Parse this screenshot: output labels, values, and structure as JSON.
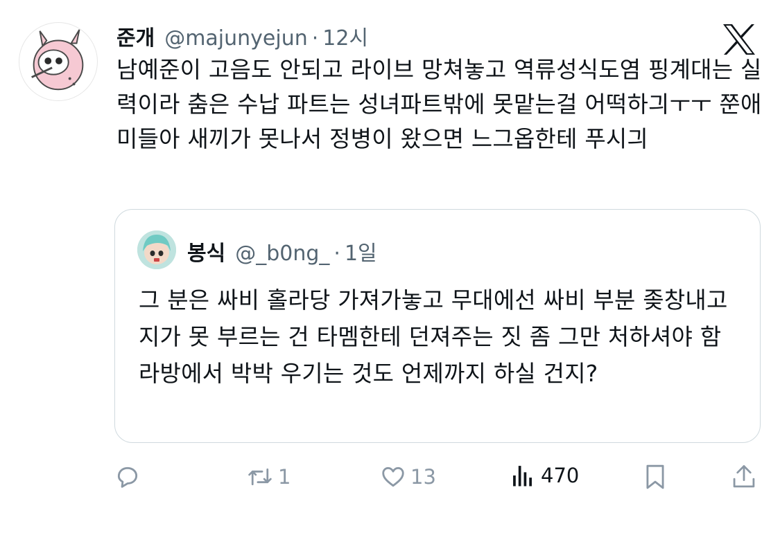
{
  "tweet": {
    "display_name": "준개",
    "handle": "@majunyejun",
    "separator": "·",
    "time": "12시",
    "text": "남예준이 고음도 안되고 라이브 망쳐놓고 역류성식도염 핑계대는 실력이라 춤은 수납 파트는 성녀파트밖에 못맡는걸 어떡하긔ㅜㅜ 쭌애미들아 새끼가 못나서 정병이 왔으면 느그옵한테 푸시긔"
  },
  "quoted_tweet": {
    "display_name": "봉식",
    "handle": "@_b0ng_",
    "separator": "·",
    "time": "1일",
    "text": "그 분은 싸비 홀라당 가져가놓고 무대에선 싸비 부분 좆창내고 지가 못 부르는 건 타멤한테 던져주는 짓 좀 그만 처하셔야 함 라방에서 박박 우기는 것도 언제까지 하실 건지?"
  },
  "actions": {
    "reply_count": "",
    "retweet_count": "1",
    "like_count": "13",
    "view_count": "470"
  },
  "icons": {
    "platform": "x-logo-icon",
    "reply": "reply-icon",
    "retweet": "retweet-icon",
    "like": "heart-icon",
    "views": "views-bar-chart-icon",
    "bookmark": "bookmark-icon",
    "share": "share-icon"
  },
  "colors": {
    "text": "#0f1419",
    "secondary": "#536471",
    "action_icon": "#8b98a5",
    "border": "#cfd9de"
  }
}
